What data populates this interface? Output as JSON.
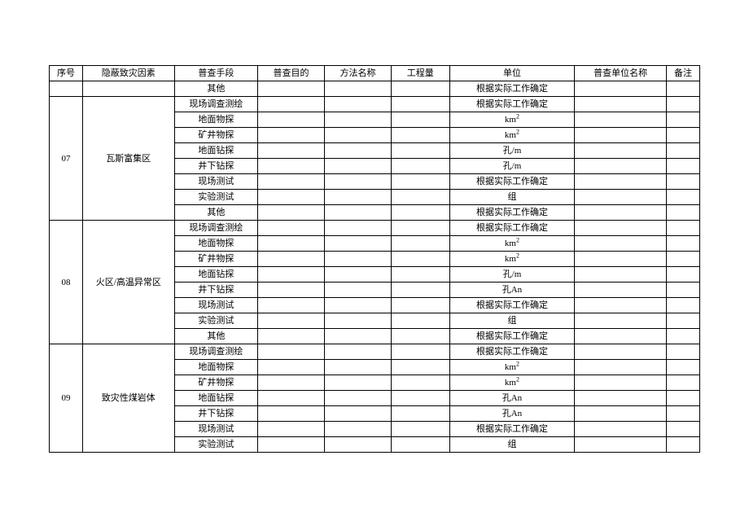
{
  "headers": {
    "seq": "序号",
    "factor": "隐蔽致灾因素",
    "method": "普查手段",
    "purpose": "普查目的",
    "method_name": "方法名称",
    "amount": "工程量",
    "unit": "单位",
    "unit_name": "普查单位名称",
    "note": "备注"
  },
  "pre_row": {
    "method": "其他",
    "unit": "根据实际工作确定"
  },
  "groups": [
    {
      "seq": "07",
      "factor": "瓦斯富集区",
      "rows": [
        {
          "method": "现场调查测绘",
          "unit": "根据实际工作确定"
        },
        {
          "method": "地面物探",
          "unit": "km²"
        },
        {
          "method": "矿井物探",
          "unit": "km²"
        },
        {
          "method": "地面钻探",
          "unit": "孔/m"
        },
        {
          "method": "井下钻探",
          "unit": "孔/m"
        },
        {
          "method": "现场测试",
          "unit": "根据实际工作确定"
        },
        {
          "method": "实验测试",
          "unit": "组"
        },
        {
          "method": "其他",
          "unit": "根据实际工作确定"
        }
      ]
    },
    {
      "seq": "08",
      "factor": "火区/高温异常区",
      "rows": [
        {
          "method": "现场调查测绘",
          "unit": "根据实际工作确定"
        },
        {
          "method": "地面物探",
          "unit": "km²"
        },
        {
          "method": "矿井物探",
          "unit": "km²"
        },
        {
          "method": "地面钻探",
          "unit": "孔/m"
        },
        {
          "method": "井下钻探",
          "unit": "孔An"
        },
        {
          "method": "现场测试",
          "unit": "根据实际工作确定"
        },
        {
          "method": "实验测试",
          "unit": "组"
        },
        {
          "method": "其他",
          "unit": "根据实际工作确定"
        }
      ]
    },
    {
      "seq": "09",
      "factor": "致灾性煤岩体",
      "rows": [
        {
          "method": "现场调查测绘",
          "unit": "根据实际工作确定"
        },
        {
          "method": "地面物探",
          "unit": "km²"
        },
        {
          "method": "矿井物探",
          "unit": "km²"
        },
        {
          "method": "地面钻探",
          "unit": "孔An"
        },
        {
          "method": "井下钻探",
          "unit": "孔An"
        },
        {
          "method": "现场测试",
          "unit": "根据实际工作确定"
        },
        {
          "method": "实验测试",
          "unit": "组"
        }
      ]
    }
  ]
}
